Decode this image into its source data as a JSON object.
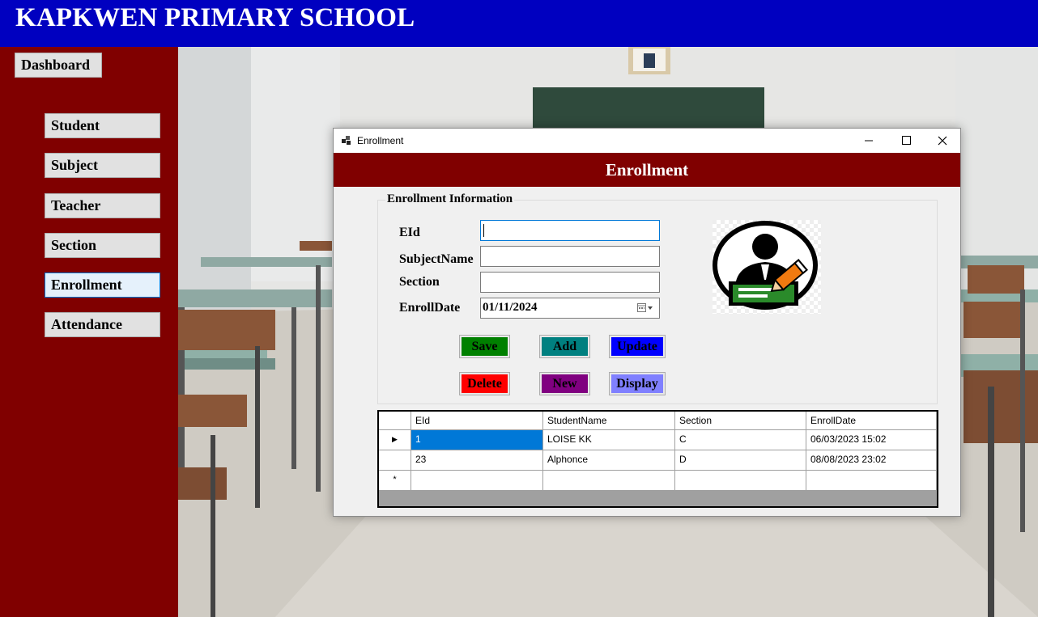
{
  "header": {
    "school_name": "KAPKWEN PRIMARY SCHOOL"
  },
  "sidebar": {
    "dashboard_label": "Dashboard",
    "items": [
      {
        "label": "Student"
      },
      {
        "label": "Subject"
      },
      {
        "label": "Teacher"
      },
      {
        "label": "Section"
      },
      {
        "label": "Enrollment",
        "active": true
      },
      {
        "label": "Attendance"
      }
    ]
  },
  "window": {
    "title": "Enrollment",
    "banner": "Enrollment",
    "group_title": "Enrollment Information",
    "fields": {
      "eid": {
        "label": "EId",
        "value": ""
      },
      "subject_name": {
        "label": "SubjectName",
        "value": ""
      },
      "section": {
        "label": "Section",
        "value": ""
      },
      "enroll_date": {
        "label": "EnrollDate",
        "value": "01/11/2024"
      }
    },
    "buttons": {
      "save": "Save",
      "add": "Add",
      "update": "Update",
      "delete": "Delete",
      "new": "New",
      "display": "Display"
    },
    "colors": {
      "save": "#008000",
      "add": "#008080",
      "update": "#0000ff",
      "delete": "#ff0000",
      "new": "#800080",
      "display": "#8080ff"
    },
    "grid": {
      "columns": [
        "EId",
        "StudentName",
        "Section",
        "EnrollDate"
      ],
      "rows": [
        [
          "1",
          "LOISE KK",
          "C",
          "06/03/2023 15:02"
        ],
        [
          "23",
          "Alphonce",
          "D",
          "08/08/2023 23:02"
        ]
      ],
      "current_row_marker": "▶",
      "new_row_marker": "*"
    }
  },
  "colors": {
    "header_bg": "#0000c0",
    "sidebar_bg": "#800000",
    "banner_bg": "#800000"
  }
}
